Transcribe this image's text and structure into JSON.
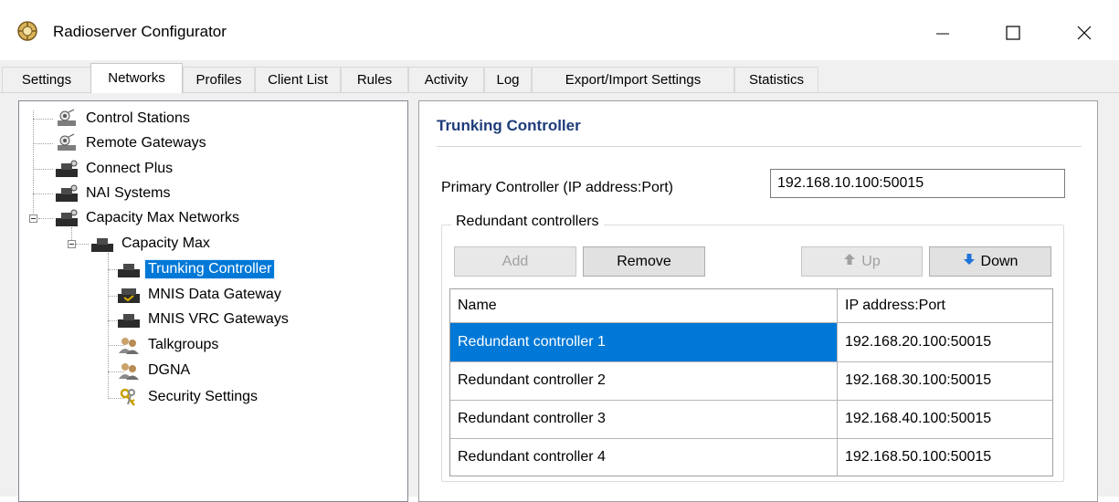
{
  "window": {
    "title": "Radioserver Configurator",
    "controls": [
      "minimize",
      "maximize",
      "close"
    ]
  },
  "tabs": [
    {
      "label": "Settings",
      "active": false
    },
    {
      "label": "Networks",
      "active": true
    },
    {
      "label": "Profiles",
      "active": false
    },
    {
      "label": "Client List",
      "active": false
    },
    {
      "label": "Rules",
      "active": false
    },
    {
      "label": "Activity",
      "active": false
    },
    {
      "label": "Log",
      "active": false
    },
    {
      "label": "Export/Import Settings",
      "active": false
    },
    {
      "label": "Statistics",
      "active": false
    }
  ],
  "tree": {
    "items": [
      {
        "label": "Control Stations",
        "icon": "radio-station-icon"
      },
      {
        "label": "Remote Gateways",
        "icon": "radio-station-icon"
      },
      {
        "label": "Connect Plus",
        "icon": "network-device-icon"
      },
      {
        "label": "NAI Systems",
        "icon": "network-device-icon"
      },
      {
        "label": "Capacity Max Networks",
        "icon": "network-device-icon",
        "expanded": true
      },
      {
        "label": "Capacity Max",
        "icon": "network-device-icon",
        "expanded": true
      },
      {
        "label": "Trunking Controller",
        "icon": "network-device-icon",
        "selected": true
      },
      {
        "label": "MNIS Data Gateway",
        "icon": "data-gateway-icon"
      },
      {
        "label": "MNIS VRC Gateways",
        "icon": "network-device-icon"
      },
      {
        "label": "Talkgroups",
        "icon": "users-icon"
      },
      {
        "label": "DGNA",
        "icon": "users-icon"
      },
      {
        "label": "Security Settings",
        "icon": "keys-icon"
      }
    ]
  },
  "panel": {
    "title": "Trunking Controller",
    "primary_label": "Primary Controller (IP address:Port)",
    "primary_value": "192.168.10.100:50015",
    "group_label": "Redundant controllers",
    "buttons": {
      "add": "Add",
      "remove": "Remove",
      "up": "Up",
      "down": "Down"
    },
    "grid": {
      "columns": [
        "Name",
        "IP address:Port"
      ],
      "rows": [
        {
          "name": "Redundant controller 1",
          "address": "192.168.20.100:50015",
          "selected": true
        },
        {
          "name": "Redundant controller 2",
          "address": "192.168.30.100:50015"
        },
        {
          "name": "Redundant controller 3",
          "address": "192.168.40.100:50015"
        },
        {
          "name": "Redundant controller 4",
          "address": "192.168.50.100:50015"
        }
      ]
    }
  },
  "colors": {
    "selection": "#0078d7",
    "panel_title": "#1f3d7a",
    "up_arrow": "#a0a0a0",
    "down_arrow": "#1e73d9"
  }
}
